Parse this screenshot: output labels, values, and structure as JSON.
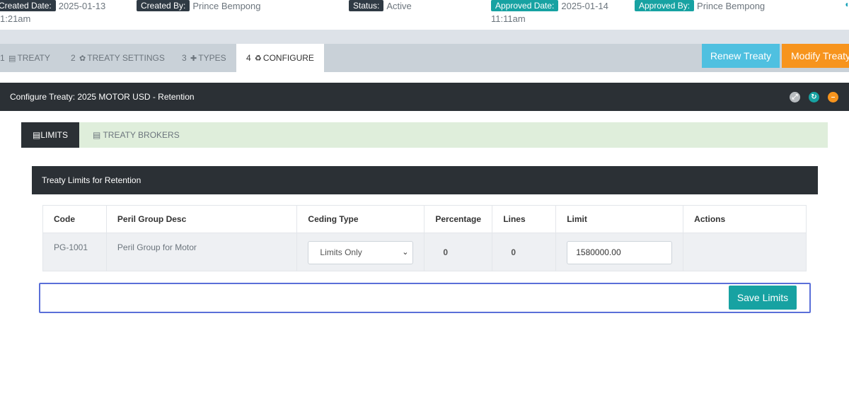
{
  "info": {
    "created_date": {
      "label": "Created Date:",
      "value": "2025-01-13",
      "value2": "1:21am"
    },
    "created_by": {
      "label": "Created By:",
      "value": "Prince Bempong"
    },
    "status": {
      "label": "Status:",
      "value": "Active"
    },
    "approved_date": {
      "label": "Approved Date:",
      "value": "2025-01-14",
      "value2": "11:11am"
    },
    "approved_by": {
      "label": "Approved By:",
      "value": "Prince Bempong"
    }
  },
  "tabs": [
    {
      "num": "1",
      "icon": "▤",
      "label": "TREATY"
    },
    {
      "num": "2",
      "icon": "✿",
      "label": "TREATY SETTINGS"
    },
    {
      "num": "3",
      "icon": "✚",
      "label": "TYPES"
    },
    {
      "num": "4",
      "icon": "♻",
      "label": "CONFIGURE"
    }
  ],
  "actions": {
    "renew": "Renew Treaty",
    "modify": "Modify Treaty"
  },
  "configure_title": "Configure Treaty: 2025 MOTOR USD - Retention",
  "subtabs": {
    "limits": "LIMITS",
    "brokers": "TREATY BROKERS"
  },
  "limits_panel": {
    "title": "Treaty Limits for Retention",
    "columns": [
      "Code",
      "Peril Group Desc",
      "Ceding Type",
      "Percentage",
      "Lines",
      "Limit",
      "Actions"
    ],
    "rows": [
      {
        "code": "PG-1001",
        "desc": "Peril Group for Motor",
        "ceding_type": "Limits Only",
        "percentage": "0",
        "lines": "0",
        "limit": "1580000.00"
      }
    ],
    "save_label": "Save Limits"
  },
  "colors": {
    "dark": "#2b3035",
    "teal": "#17a2a2",
    "orange": "#f7941d",
    "info": "#4fc0e0",
    "green_bar": "#dfeedb"
  }
}
